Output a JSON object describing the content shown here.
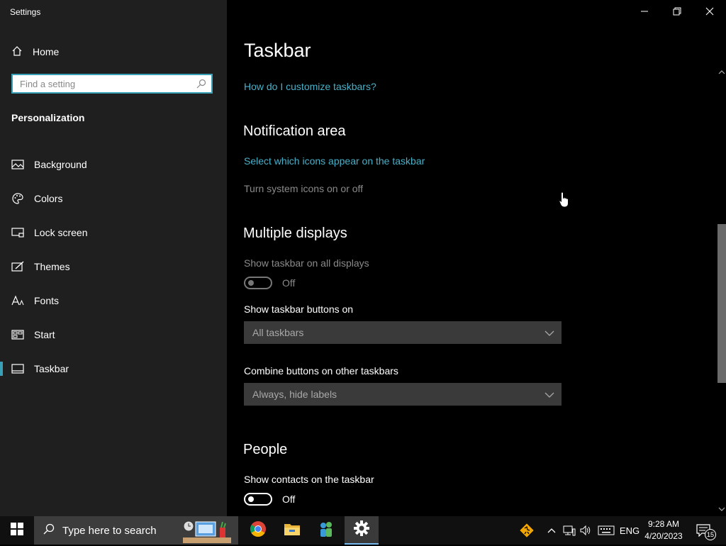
{
  "app_title": "Settings",
  "sidebar": {
    "home_label": "Home",
    "search_placeholder": "Find a setting",
    "section_title": "Personalization",
    "items": [
      {
        "label": "Background",
        "icon": "picture-icon"
      },
      {
        "label": "Colors",
        "icon": "palette-icon"
      },
      {
        "label": "Lock screen",
        "icon": "monitor-icon"
      },
      {
        "label": "Themes",
        "icon": "brush-icon"
      },
      {
        "label": "Fonts",
        "icon": "font-icon"
      },
      {
        "label": "Start",
        "icon": "start-icon"
      },
      {
        "label": "Taskbar",
        "icon": "taskbar-icon",
        "active": true
      }
    ]
  },
  "main": {
    "title": "Taskbar",
    "help_link": "How do I customize taskbars?",
    "notification_area": {
      "heading": "Notification area",
      "link1": "Select which icons appear on the taskbar",
      "link2": "Turn system icons on or off"
    },
    "multiple_displays": {
      "heading": "Multiple displays",
      "show_all_label": "Show taskbar on all displays",
      "show_all_state": "Off",
      "buttons_on_label": "Show taskbar buttons on",
      "buttons_on_value": "All taskbars",
      "combine_label": "Combine buttons on other taskbars",
      "combine_value": "Always, hide labels"
    },
    "people": {
      "heading": "People",
      "contacts_label": "Show contacts on the taskbar",
      "contacts_state": "Off"
    }
  },
  "taskbar": {
    "search_placeholder": "Type here to search",
    "language": "ENG",
    "time": "9:28 AM",
    "date": "4/20/2023",
    "notification_count": "15"
  },
  "colors": {
    "accent": "#48b0c9",
    "sidebar_bg": "#1f1f1f",
    "main_bg": "#000000",
    "taskbar_bg": "#101010"
  }
}
